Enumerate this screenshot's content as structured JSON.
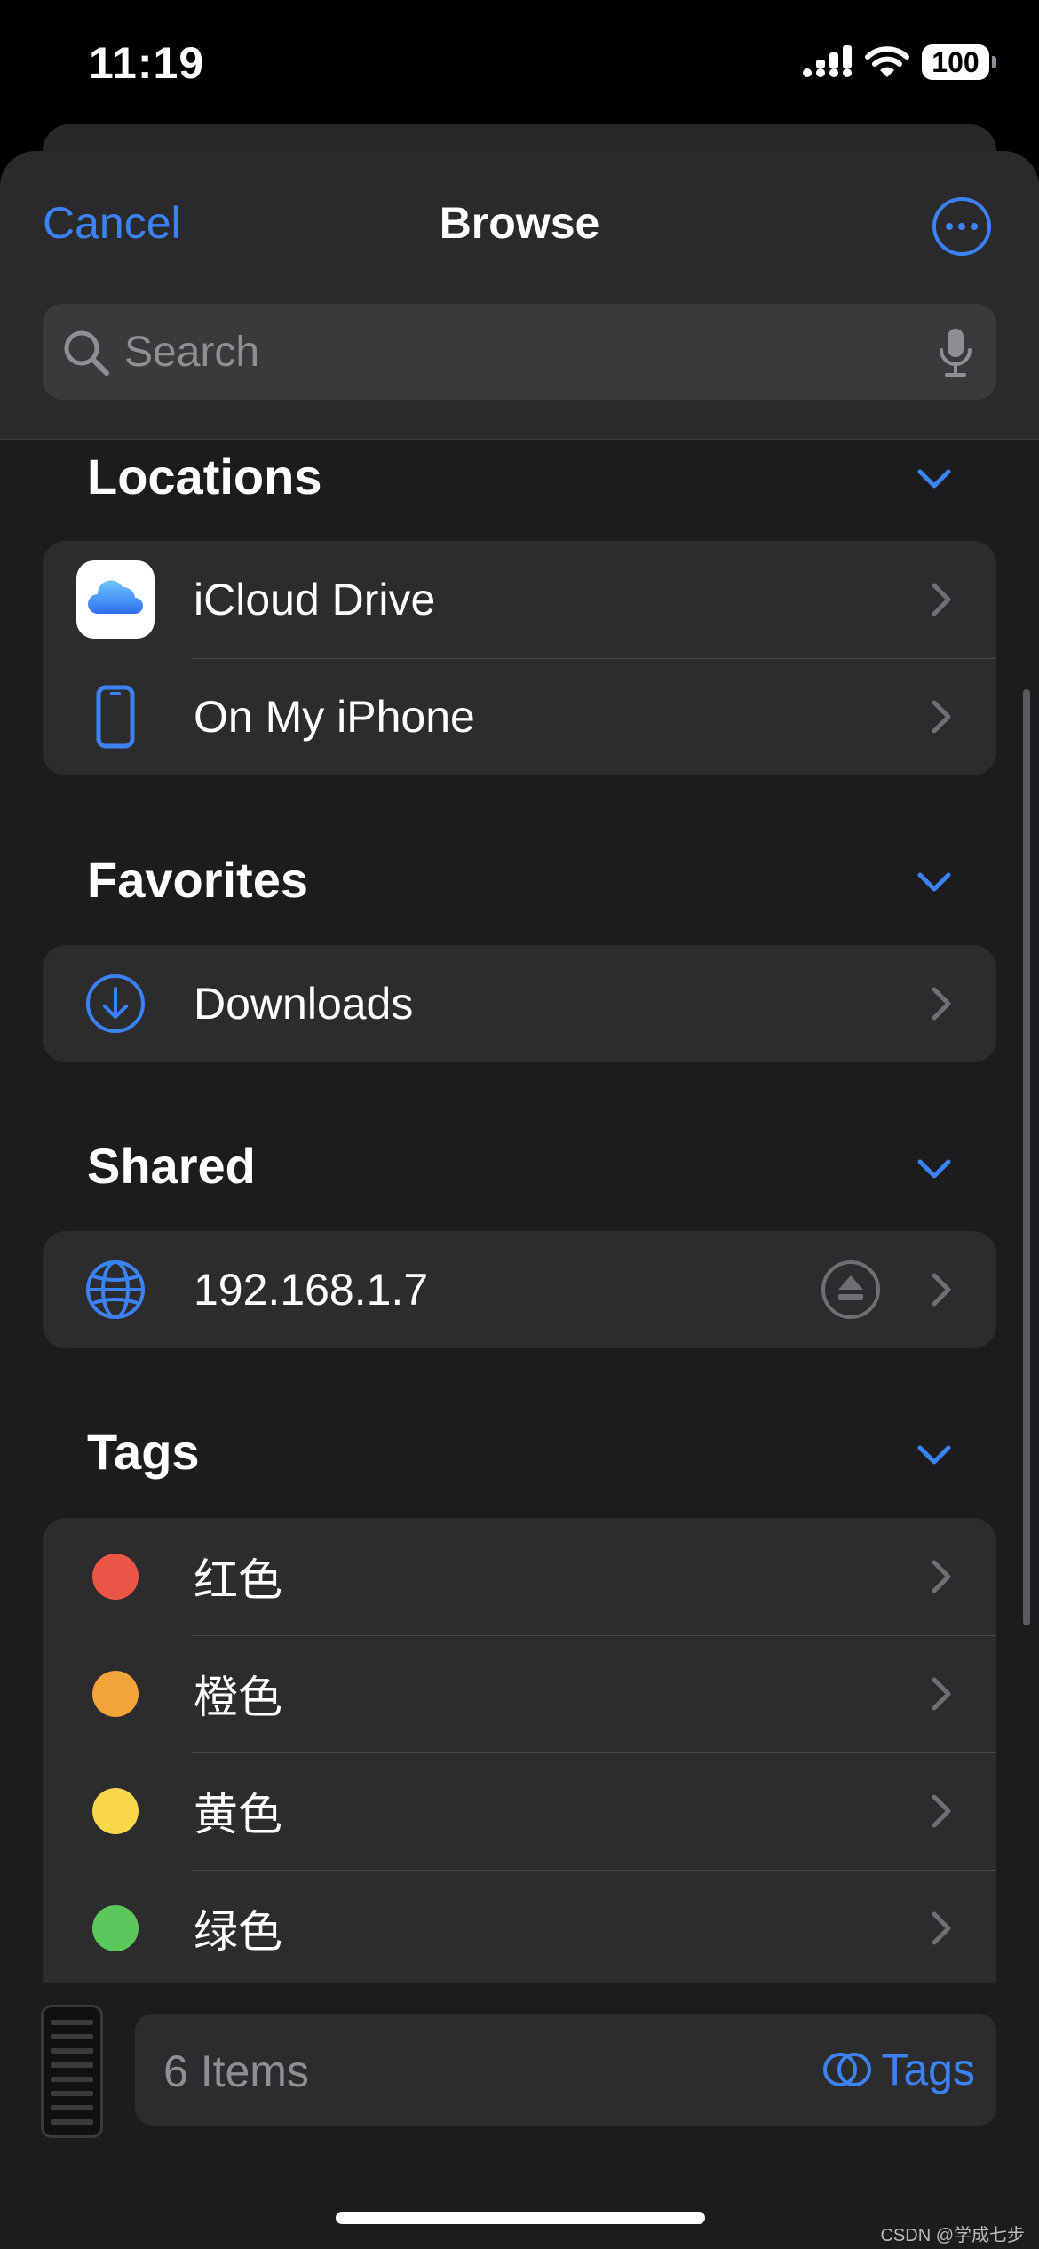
{
  "status_bar": {
    "time": "11:19",
    "battery": "100"
  },
  "header": {
    "cancel_label": "Cancel",
    "title": "Browse"
  },
  "search": {
    "placeholder": "Search"
  },
  "sections": {
    "locations": {
      "title": "Locations",
      "items": [
        {
          "label": "iCloud Drive",
          "icon": "icloud-icon"
        },
        {
          "label": "On My iPhone",
          "icon": "iphone-icon"
        }
      ]
    },
    "favorites": {
      "title": "Favorites",
      "items": [
        {
          "label": "Downloads",
          "icon": "download-icon"
        }
      ]
    },
    "shared": {
      "title": "Shared",
      "items": [
        {
          "label": "192.168.1.7",
          "icon": "globe-icon"
        }
      ]
    },
    "tags": {
      "title": "Tags",
      "items": [
        {
          "label": "红色",
          "color": "#eb5545"
        },
        {
          "label": "橙色",
          "color": "#f2a33a"
        },
        {
          "label": "黄色",
          "color": "#f8d84a"
        },
        {
          "label": "绿色",
          "color": "#5ac85a"
        }
      ]
    }
  },
  "bottom_bar": {
    "items_count": "6 Items",
    "tags_label": "Tags"
  },
  "watermark": "CSDN @学成七步",
  "colors": {
    "accent": "#3b82f6",
    "background": "#1c1c1e",
    "group": "#2c2c2e"
  }
}
